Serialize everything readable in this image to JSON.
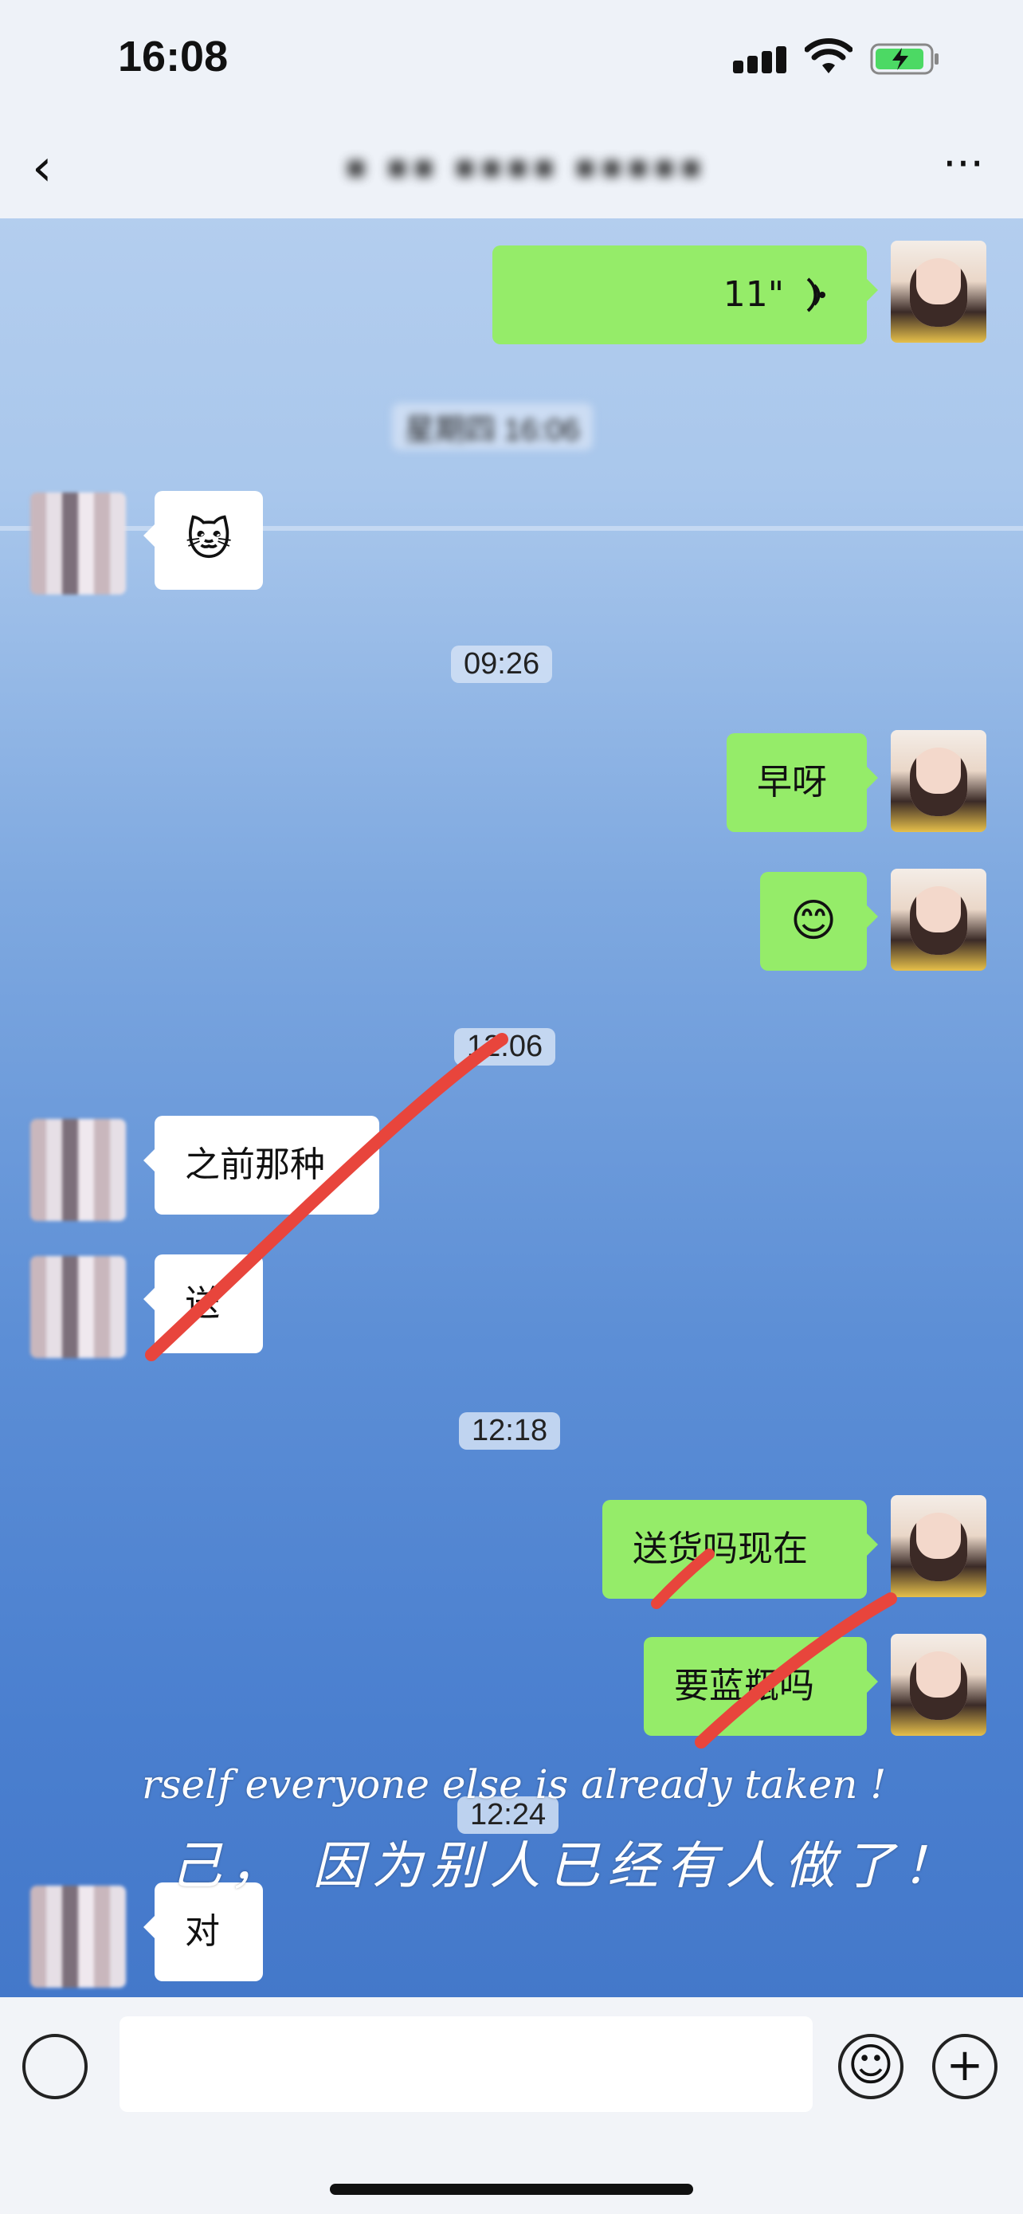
{
  "status": {
    "time": "16:08"
  },
  "nav": {
    "back": "‹",
    "title": "▪ ▪▪ ▪▪▪▪ ▪▪▪▪▪",
    "more": "···"
  },
  "messages": {
    "voice": {
      "duration": "11\"",
      "icon": "voice-wave-icon"
    },
    "stamp_weekday": "星期四 16:06",
    "cat_emoji": "🐱",
    "stamp_0926": "09:26",
    "morning": "早呀",
    "smile": "😊",
    "stamp_1206": "12:06",
    "prev_kind": "之前那种",
    "send": "送",
    "stamp_1218": "12:18",
    "deliver_now": "送货吗现在",
    "want_blue": "要蓝瓶吗",
    "stamp_1224": "12:24",
    "yes": "对"
  },
  "overlay": {
    "line_en": "rself everyone else is already taken !",
    "line_zh": "己， 因为别人已经有人做了！"
  },
  "bottom": {
    "voice_icon": "voice-icon",
    "emoji_icon": "☺",
    "plus_icon": "+"
  },
  "colors": {
    "my_bubble": "#95ec69",
    "other_bubble": "#ffffff",
    "stroke": "#e8453c"
  }
}
